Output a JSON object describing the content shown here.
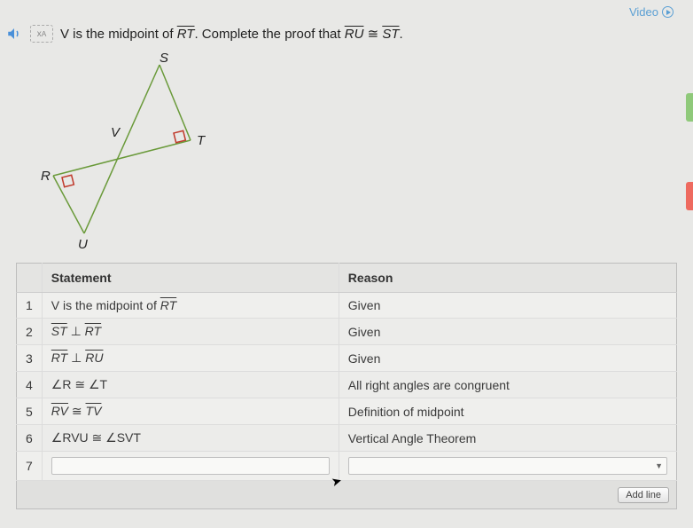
{
  "topRight": {
    "videoLabel": "Video"
  },
  "prompt": {
    "part1": "V is the midpoint of ",
    "seg1": "RT",
    "part2": ". Complete the proof that ",
    "seg2": "RU",
    "congruent": " ≅ ",
    "seg3": "ST",
    "part3": "."
  },
  "diagram": {
    "labels": {
      "S": "S",
      "T": "T",
      "V": "V",
      "R": "R",
      "U": "U"
    }
  },
  "table": {
    "headers": {
      "statement": "Statement",
      "reason": "Reason"
    },
    "rows": [
      {
        "n": "1",
        "statement_pre": "V is the midpoint of ",
        "statement_seg": "RT",
        "reason": "Given"
      },
      {
        "n": "2",
        "statement_html": "ST ⊥ RT",
        "reason": "Given"
      },
      {
        "n": "3",
        "statement_html": "RT ⊥ RU",
        "reason": "Given"
      },
      {
        "n": "4",
        "statement_html": "∠R ≅ ∠T",
        "reason": "All right angles are congruent"
      },
      {
        "n": "5",
        "statement_html": "RV ≅ TV",
        "reason": "Definition of midpoint"
      },
      {
        "n": "6",
        "statement_html": "∠RVU ≅ ∠SVT",
        "reason": "Vertical Angle Theorem"
      },
      {
        "n": "7"
      }
    ]
  },
  "buttons": {
    "addLine": "Add line"
  }
}
